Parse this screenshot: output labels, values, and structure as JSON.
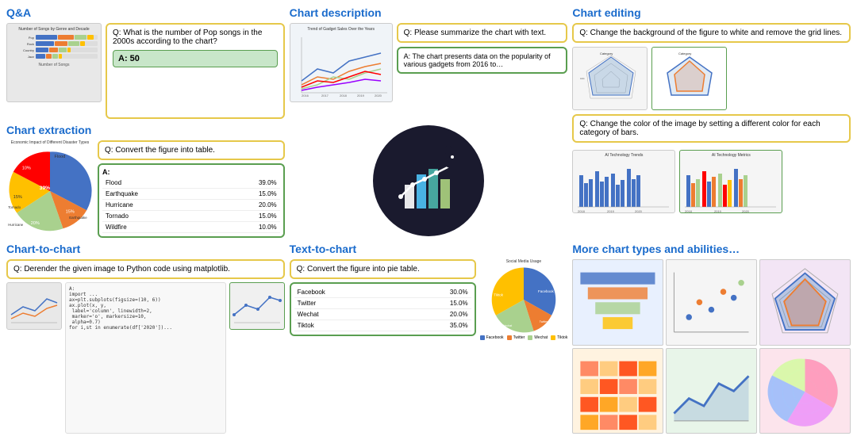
{
  "sections": {
    "qa": {
      "title": "Q&A",
      "question": "Q: What is the number of Pop songs in the 2000s according to the chart?",
      "answer": "A: 50",
      "chart_title": "Number of Songs by Genre and Decade"
    },
    "chart_desc": {
      "title": "Chart description",
      "question": "Q: Please summarize the chart with text.",
      "answer": "A: The chart presents data on the popularity of various gadgets from 2016 to…",
      "chart_title": "Trend of Gadget Sales Over the Years"
    },
    "chart_edit": {
      "title": "Chart editing",
      "q1": "Q: Change the background of the figure to white and remove the grid lines.",
      "q2": "Q: Change the color of the image by setting a different color for each category of bars."
    },
    "chart_extract": {
      "title": "Chart extraction",
      "question": "Q: Convert the figure into table.",
      "answer_label": "A:",
      "chart_title": "Economic Impact of Different Disaster Types",
      "table_rows": [
        {
          "label": "Flood",
          "value": "39.0%"
        },
        {
          "label": "Earthquake",
          "value": "15.0%"
        },
        {
          "label": "Hurricane",
          "value": "20.0%"
        },
        {
          "label": "Tornado",
          "value": "15.0%"
        },
        {
          "label": "Wildfire",
          "value": "10.0%"
        }
      ]
    },
    "chart_to_chart": {
      "title": "Chart-to-chart",
      "question": "Q: Derender the given image to Python code using matplotlib.",
      "answer_label": "A:",
      "code_lines": [
        "import ...",
        "ax=plt.subplots(figsize=(10, 6))",
        "ax.plot(x, y,",
        "  label='column', linewidth=2,",
        "  marker='o', markersize=10,",
        "  alpha=0.7)",
        "for i,st in enumerate(df['2020'])..."
      ]
    },
    "text_to_chart": {
      "title": "Text-to-chart",
      "question": "Q: Convert the figure into pie table.",
      "table_rows": [
        {
          "label": "Facebook",
          "value": "30.0%"
        },
        {
          "label": "Twitter",
          "value": "15.0%"
        },
        {
          "label": "Wechat",
          "value": "20.0%"
        },
        {
          "label": "Tiktok",
          "value": "35.0%"
        }
      ],
      "chart_title": "Social Media Usage",
      "legend": [
        "Facebook",
        "Twitter",
        "Wechat",
        "Tiktok"
      ]
    },
    "more_charts": {
      "title": "More chart types and abilities…"
    }
  },
  "colors": {
    "title_blue": "#1a6bcc",
    "border_yellow": "#e6c84a",
    "border_green": "#5a9e50",
    "bar1": "#4472C4",
    "bar2": "#ED7D31",
    "bar3": "#A9D18E",
    "bar4": "#FF0000",
    "bar5": "#FFC000",
    "pie_flood": "#4472C4",
    "pie_earthquake": "#ED7D31",
    "pie_hurricane": "#A9D18E",
    "pie_tornado": "#FFC000",
    "pie_wildfire": "#FF0000",
    "social_facebook": "#4472C4",
    "social_twitter": "#ED7D31",
    "social_wechat": "#A9D18E",
    "social_tiktok": "#FFC000"
  }
}
